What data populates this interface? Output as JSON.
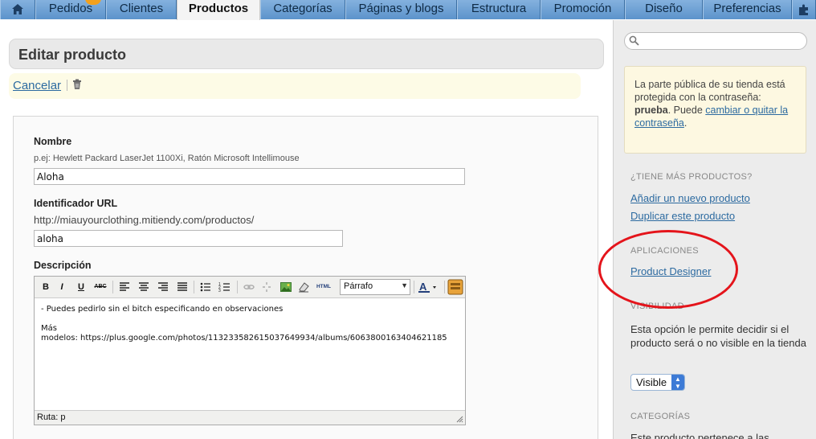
{
  "nav": {
    "tabs": [
      "Pedidos",
      "Clientes",
      "Productos",
      "Categorías",
      "Páginas y blogs",
      "Estructura",
      "Promoción",
      "Diseño",
      "Preferencias"
    ],
    "active": "Productos"
  },
  "page": {
    "title": "Editar producto",
    "cancel_label": "Cancelar"
  },
  "form": {
    "name_label": "Nombre",
    "name_hint": "p.ej: Hewlett Packard LaserJet 1100Xi, Ratón Microsoft Intellimouse",
    "name_value": "Aloha",
    "url_label": "Identificador URL",
    "url_prefix": "http://miauyourclothing.mitiendy.com/productos/",
    "url_value": "aloha",
    "desc_label": "Descripción"
  },
  "editor": {
    "format_value": "Párrafo",
    "html_label": "HTML",
    "content_lines": [
      "- Puedes pedirlo sin el bitch especificando en observaciones",
      "",
      "Más",
      "modelos: https://plus.google.com/photos/113233582615037649934/albums/6063800163404621185"
    ],
    "status_path": "Ruta: p"
  },
  "sidebar": {
    "notice_before": "La parte pública de su tienda está protegida con la contraseña: ",
    "notice_password": "prueba",
    "notice_middle": ". Puede ",
    "notice_link": "cambiar o quitar la contraseña",
    "notice_end": ".",
    "more_products_heading": "¿TIENE MÁS PRODUCTOS?",
    "add_product_link": "Añadir un nuevo producto",
    "duplicate_product_link": "Duplicar este producto",
    "apps_heading": "APLICACIONES",
    "product_designer_link": "Product Designer",
    "visibility_heading": "VISIBILIDAD",
    "visibility_desc": "Esta opción le permite decidir si el producto será o no visible en la tienda",
    "visibility_value": "Visible",
    "categories_heading": "CATEGORÍAS",
    "categories_desc": "Este producto pertenece a las"
  },
  "colors": {
    "nav_bg": "#4a82b8",
    "link": "#2c6aa0",
    "annotation": "#e4141b"
  }
}
